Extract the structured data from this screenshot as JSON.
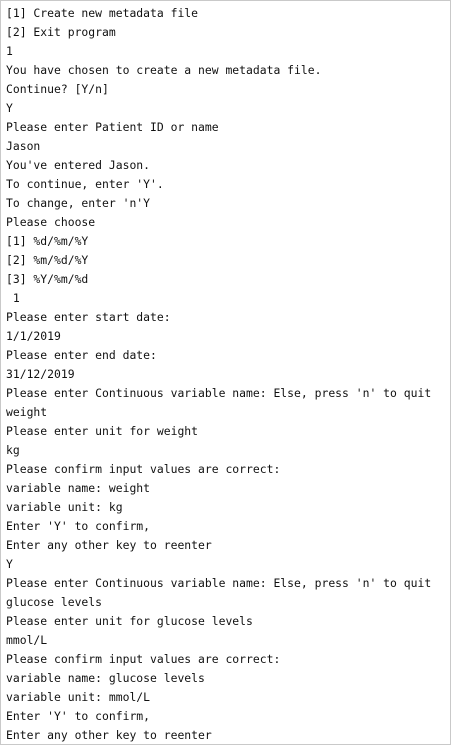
{
  "terminal": {
    "lines": [
      "[1] Create new metadata file",
      "[2] Exit program",
      "1",
      "You have chosen to create a new metadata file.",
      "Continue? [Y/n]",
      "Y",
      "Please enter Patient ID or name",
      "Jason",
      "You've entered Jason.",
      "To continue, enter 'Y'.",
      "To change, enter 'n'Y",
      "Please choose",
      "[1] %d/%m/%Y",
      "[2] %m/%d/%Y",
      "[3] %Y/%m/%d",
      " 1",
      "Please enter start date:",
      "1/1/2019",
      "Please enter end date:",
      "31/12/2019",
      "Please enter Continuous variable name: Else, press 'n' to quit",
      "weight",
      "Please enter unit for weight",
      "kg",
      "Please confirm input values are correct:",
      "variable name: weight",
      "variable unit: kg",
      "Enter 'Y' to confirm,",
      "Enter any other key to reenter",
      "Y",
      "Please enter Continuous variable name: Else, press 'n' to quit",
      "glucose levels",
      "Please enter unit for glucose levels",
      "mmol/L",
      "Please confirm input values are correct:",
      "variable name: glucose levels",
      "variable unit: mmol/L",
      "Enter 'Y' to confirm,",
      "Enter any other key to reenter"
    ]
  }
}
